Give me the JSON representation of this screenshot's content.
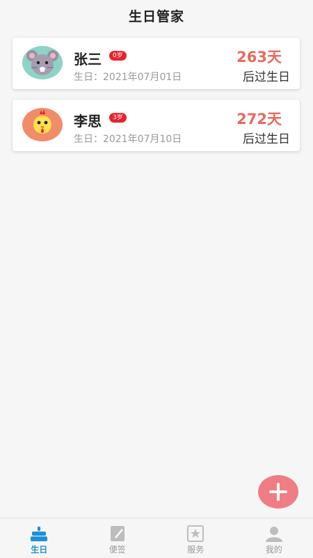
{
  "header": {
    "title": "生日管家"
  },
  "people": [
    {
      "name": "张三",
      "age_badge": "0岁",
      "birthday": "生日：2021年07月01日",
      "days": "263天",
      "suffix": "后过生日",
      "avatar_icon": "mouse-avatar-icon",
      "avatar_bg": "#8dd3c7"
    },
    {
      "name": "李思",
      "age_badge": "3岁",
      "birthday": "生日：2021年07月10日",
      "days": "272天",
      "suffix": "后过生日",
      "avatar_icon": "rooster-avatar-icon",
      "avatar_bg": "#f08c67"
    }
  ],
  "fab": {
    "icon": "plus-icon",
    "color": "#f07d84"
  },
  "tabbar": {
    "items": [
      {
        "label": "生日",
        "icon": "cake-icon",
        "active": true
      },
      {
        "label": "便签",
        "icon": "note-icon",
        "active": false
      },
      {
        "label": "服务",
        "icon": "star-icon",
        "active": false
      },
      {
        "label": "我的",
        "icon": "user-icon",
        "active": false
      }
    ]
  },
  "colors": {
    "accent": "#1e90d8",
    "days": "#e96a5c",
    "badge": "#e8232b"
  }
}
